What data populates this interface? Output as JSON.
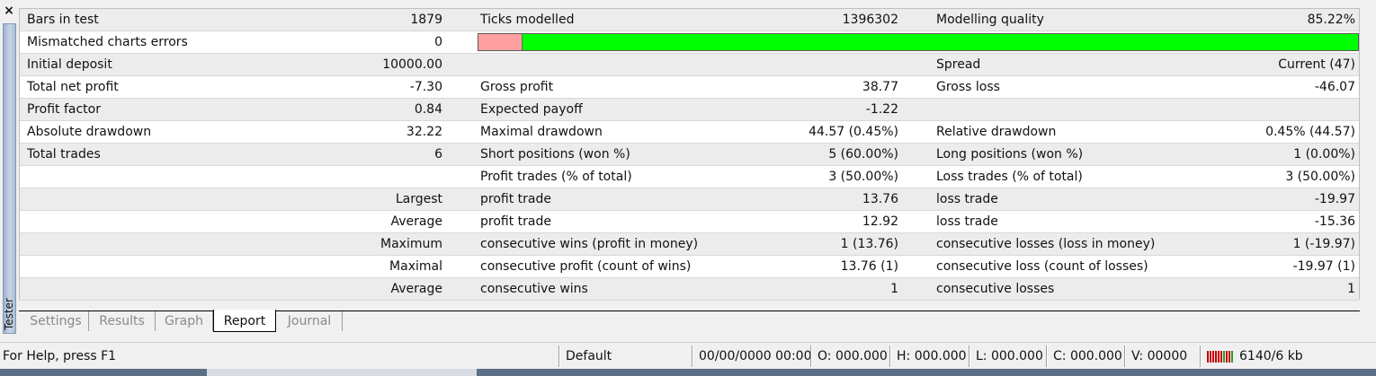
{
  "window": {
    "close_label": "×",
    "side_label": "Tester"
  },
  "report": {
    "row0": {
      "label1": "Bars in test",
      "value1": "1879",
      "label2": "Ticks modelled",
      "value2": "1396302",
      "label3": "Modelling quality",
      "value3": "85.22%"
    },
    "row1": {
      "label1": "Mismatched charts errors",
      "value1": "0",
      "quality_bar": {
        "red_fraction": 0.05,
        "red_color": "#ffa0a0",
        "green_color": "#00ff00"
      }
    },
    "row2": {
      "label1": "Initial deposit",
      "value1": "10000.00",
      "label3": "Spread",
      "value3": "Current (47)"
    },
    "row3": {
      "label1": "Total net profit",
      "value1": "-7.30",
      "label2": "Gross profit",
      "value2": "38.77",
      "label3": "Gross loss",
      "value3": "-46.07"
    },
    "row4": {
      "label1": "Profit factor",
      "value1": "0.84",
      "label2": "Expected payoff",
      "value2": "-1.22"
    },
    "row5": {
      "label1": "Absolute drawdown",
      "value1": "32.22",
      "label2": "Maximal drawdown",
      "value2": "44.57 (0.45%)",
      "label3": "Relative drawdown",
      "value3": "0.45% (44.57)"
    },
    "row6": {
      "label1": "Total trades",
      "value1": "6",
      "label2": "Short positions (won %)",
      "value2": "5 (60.00%)",
      "label3": "Long positions (won %)",
      "value3": "1 (0.00%)"
    },
    "row7": {
      "label2": "Profit trades (% of total)",
      "value2": "3 (50.00%)",
      "label3": "Loss trades (% of total)",
      "value3": "3 (50.00%)"
    },
    "row8": {
      "label1": "Largest",
      "label2": "profit trade",
      "value2": "13.76",
      "label3": "loss trade",
      "value3": "-19.97"
    },
    "row9": {
      "label1": "Average",
      "label2": "profit trade",
      "value2": "12.92",
      "label3": "loss trade",
      "value3": "-15.36"
    },
    "row10": {
      "label1": "Maximum",
      "label2": "consecutive wins (profit in money)",
      "value2": "1 (13.76)",
      "label3": "consecutive losses (loss in money)",
      "value3": "1 (-19.97)"
    },
    "row11": {
      "label1": "Maximal",
      "label2": "consecutive profit (count of wins)",
      "value2": "13.76 (1)",
      "label3": "consecutive loss (count of losses)",
      "value3": "-19.97 (1)"
    },
    "row12": {
      "label1": "Average",
      "label2": "consecutive wins",
      "value2": "1",
      "label3": "consecutive losses",
      "value3": "1"
    }
  },
  "tabs": [
    {
      "label": "Settings",
      "active": false
    },
    {
      "label": "Results",
      "active": false
    },
    {
      "label": "Graph",
      "active": false
    },
    {
      "label": "Report",
      "active": true
    },
    {
      "label": "Journal",
      "active": false
    }
  ],
  "statusbar": {
    "help": "For Help, press F1",
    "profile": "Default",
    "datetime": "00/00/0000 00:00",
    "open": "O: 000.000",
    "high": "H: 000.000",
    "low": "L: 000.000",
    "close": "C: 000.000",
    "volume": "V: 00000",
    "traffic": "6140/6 kb"
  }
}
